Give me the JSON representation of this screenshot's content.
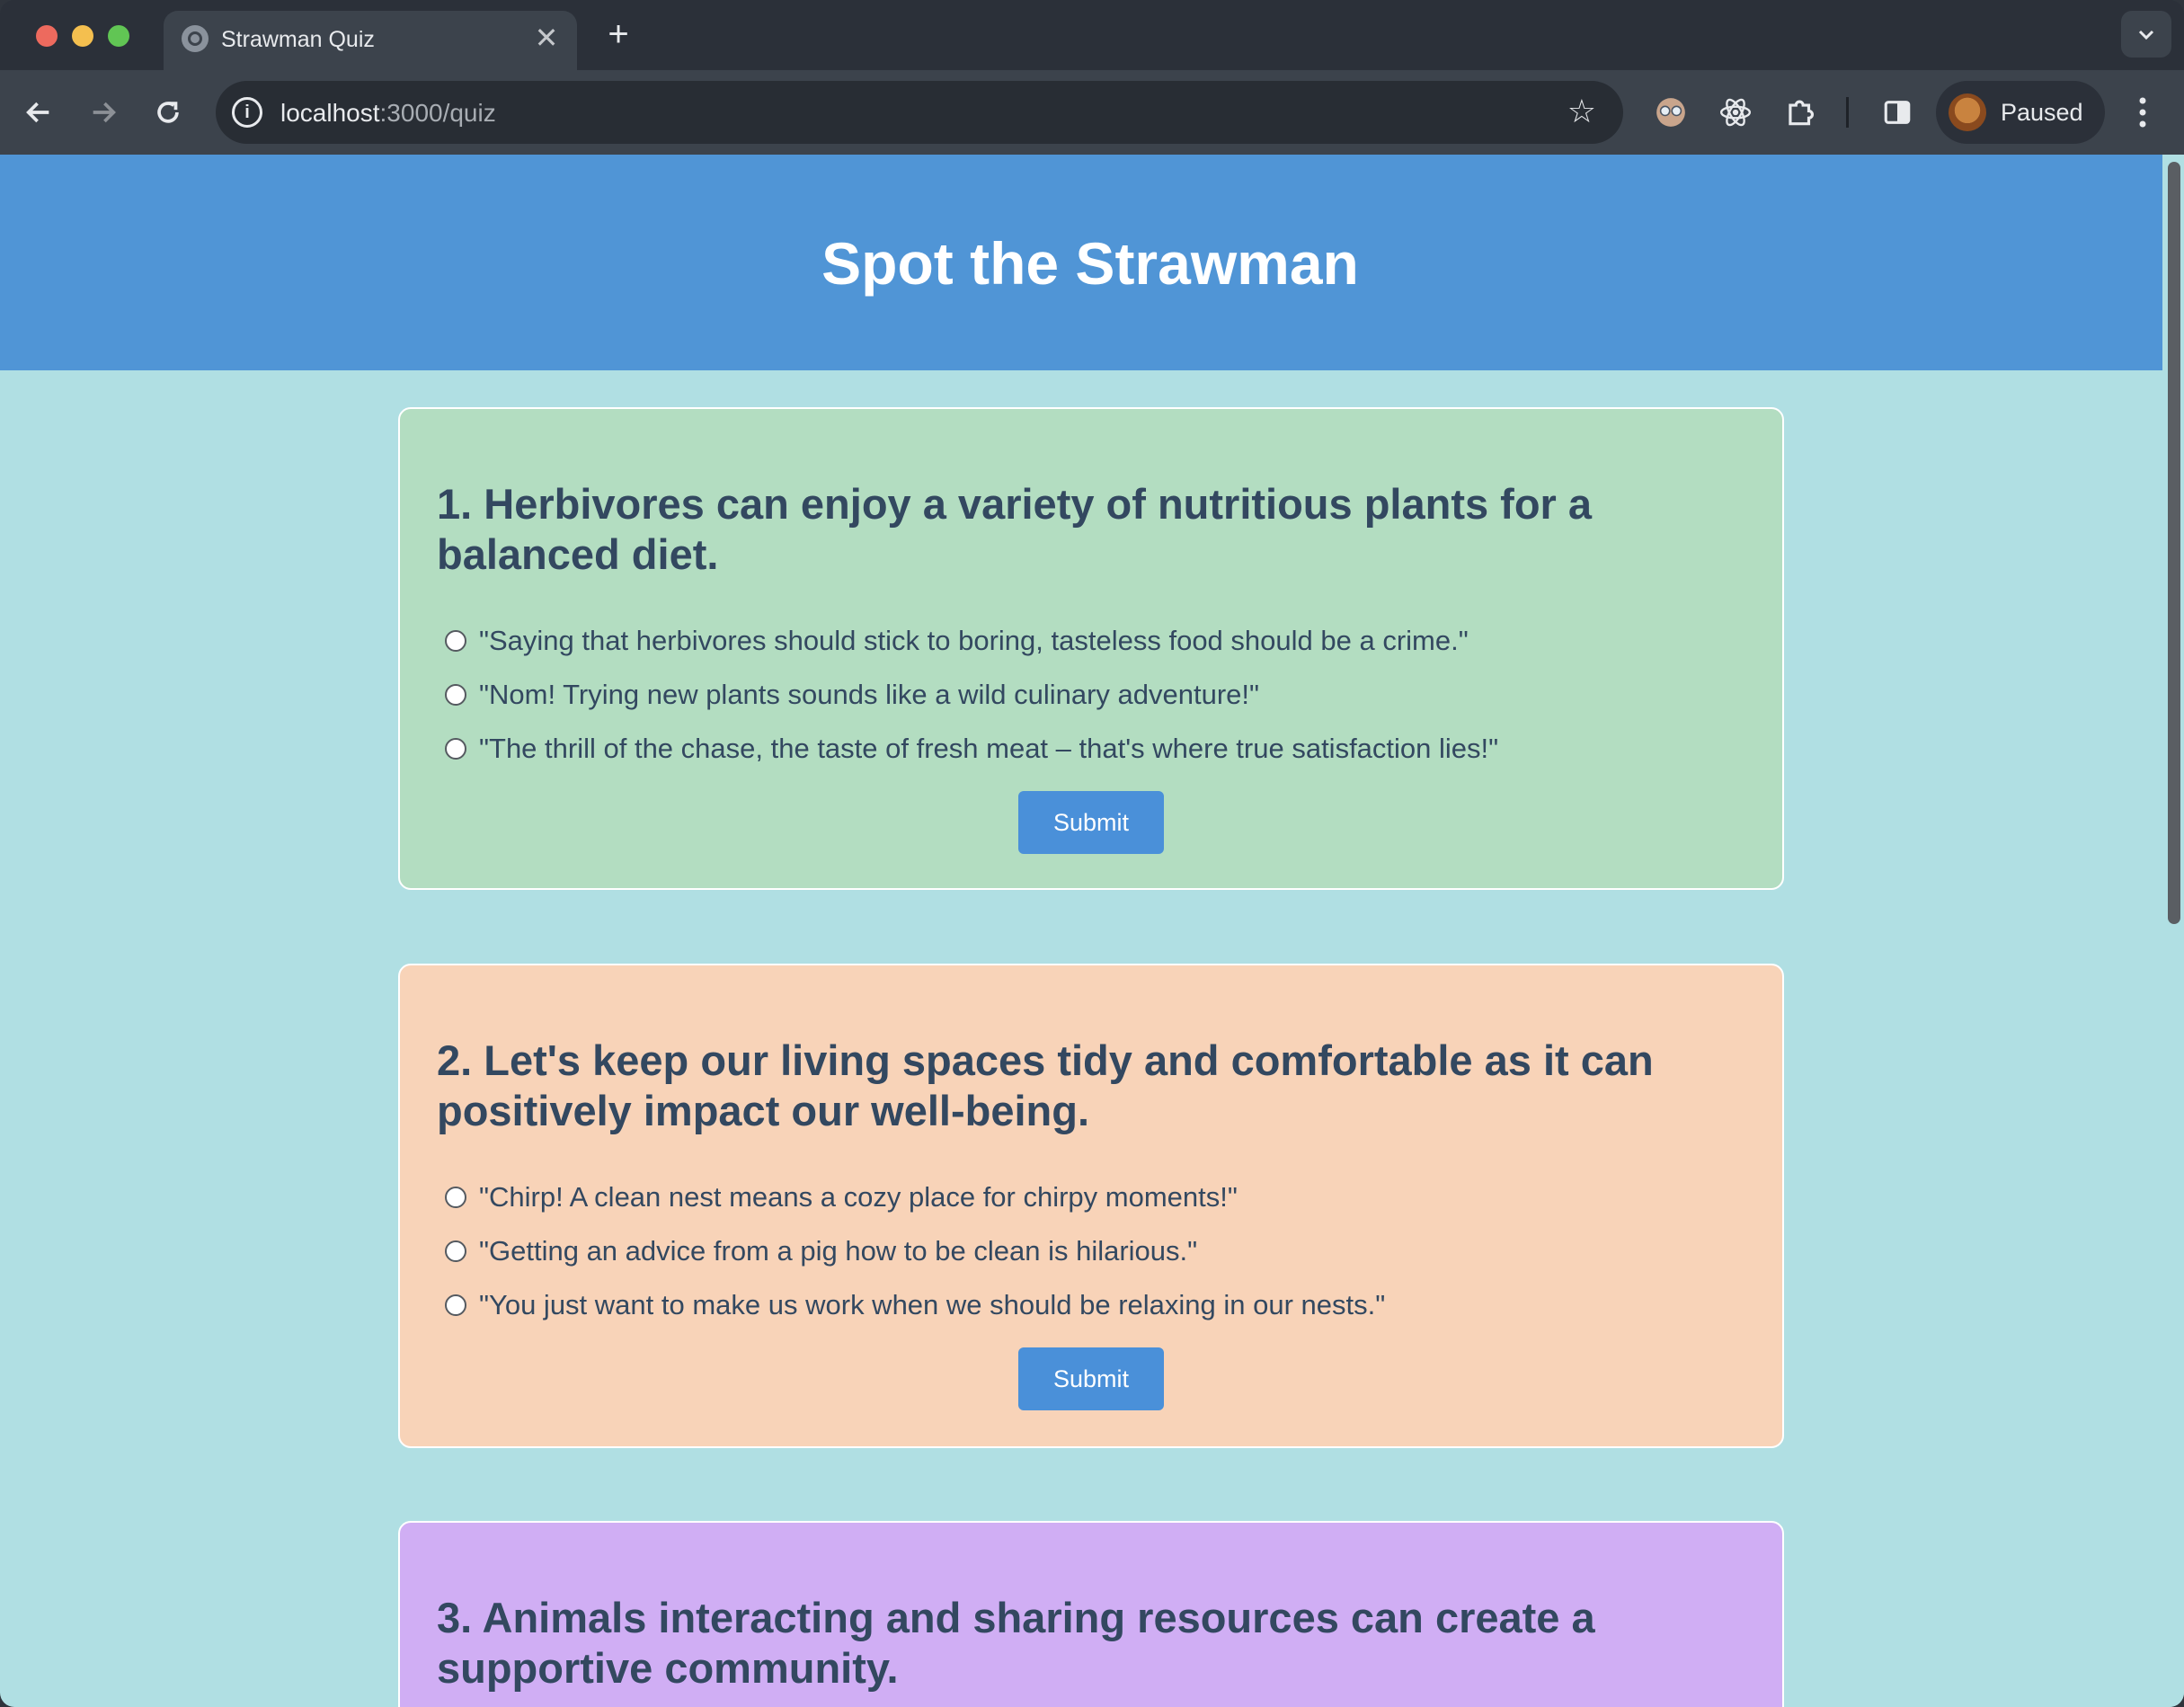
{
  "browser": {
    "tab_title": "Strawman Quiz",
    "tab_close": "✕",
    "new_tab": "+",
    "url_host": "localhost",
    "url_path": ":3000/quiz",
    "profile_label": "Paused"
  },
  "page": {
    "title": "Spot the Strawman"
  },
  "questions": [
    {
      "text": "1. Herbivores can enjoy a variety of nutritious plants for a balanced diet.",
      "options": [
        "\"Saying that herbivores should stick to boring, tasteless food should be a crime.\"",
        "\"Nom! Trying new plants sounds like a wild culinary adventure!\"",
        "\"The thrill of the chase, the taste of fresh meat – that's where true satisfaction lies!\""
      ],
      "submit_label": "Submit",
      "color": "#b3ddc1"
    },
    {
      "text": "2. Let's keep our living spaces tidy and comfortable as it can positively impact our well-being.",
      "options": [
        "\"Chirp! A clean nest means a cozy place for chirpy moments!\"",
        "\"Getting an advice from a pig how to be clean is hilarious.\"",
        "\"You just want to make us work when we should be relaxing in our nests.\""
      ],
      "submit_label": "Submit",
      "color": "#f8d3b8"
    },
    {
      "text": "3. Animals interacting and sharing resources can create a supportive community.",
      "color": "#d0aef4"
    }
  ],
  "colors": {
    "header_bg": "#5095d6",
    "page_bg": "#b0dfe3",
    "button_bg": "#4a90d9",
    "text": "#334860"
  }
}
